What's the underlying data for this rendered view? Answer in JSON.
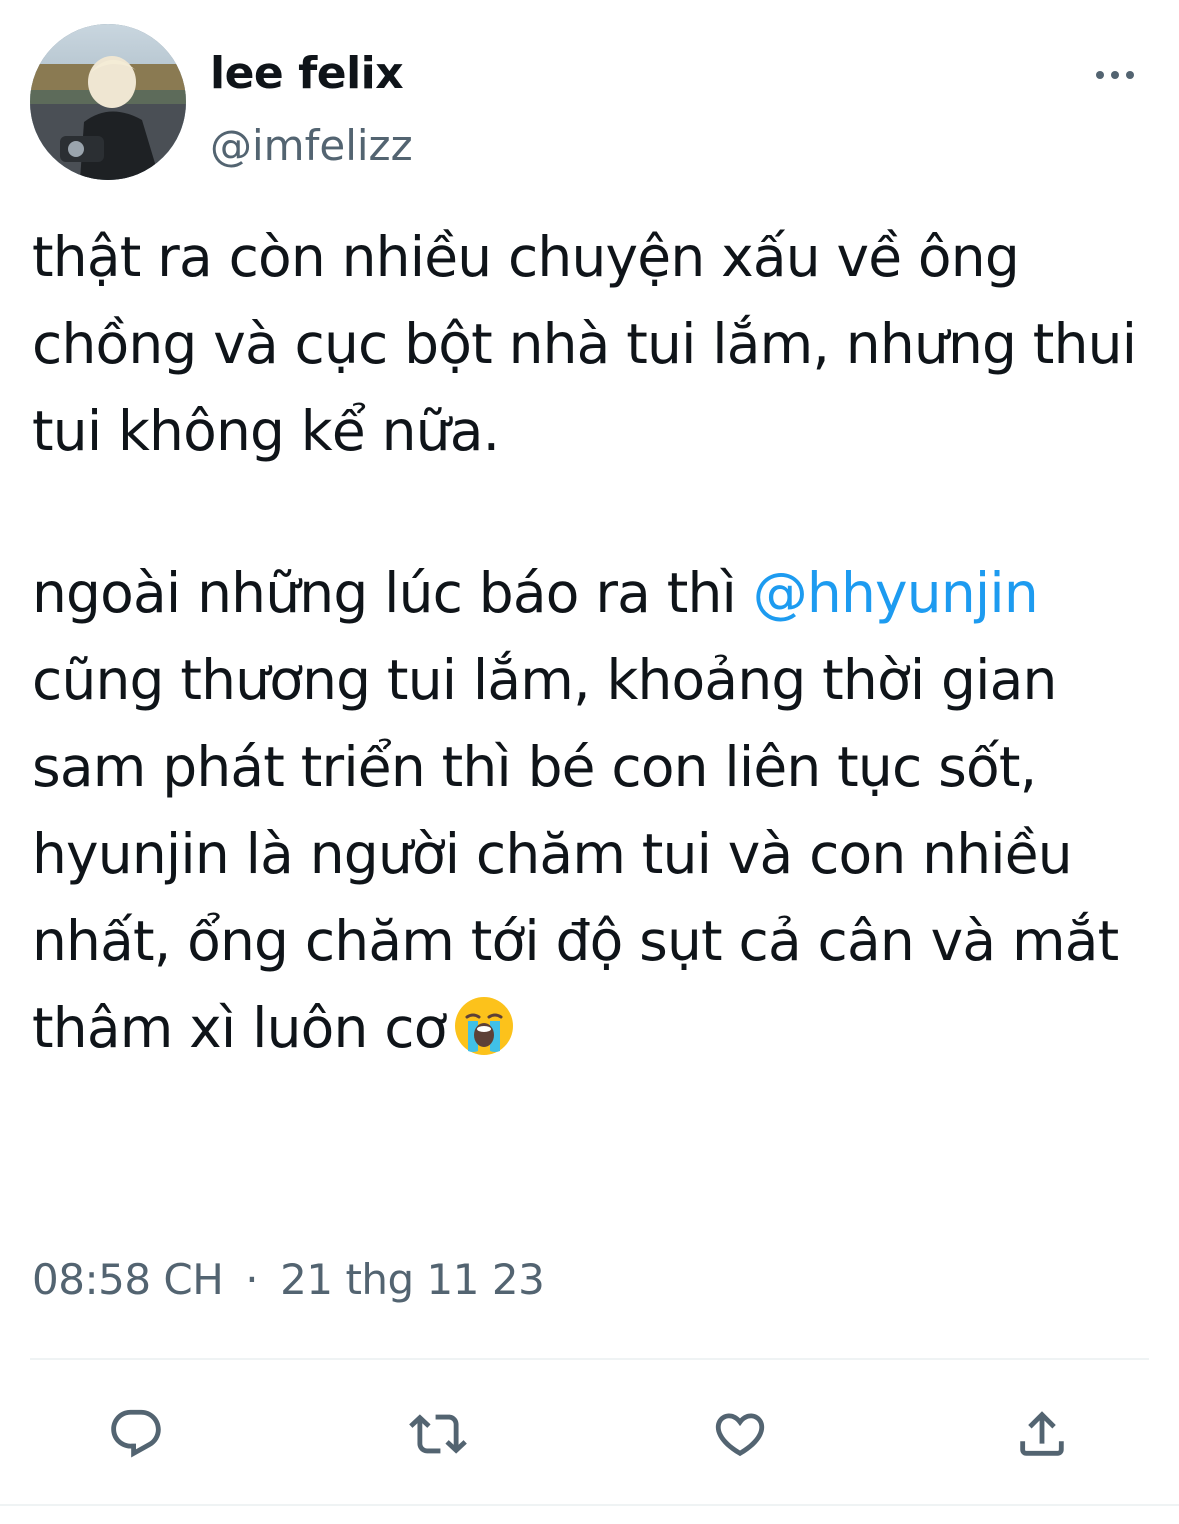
{
  "author": {
    "display_name": "lee felix",
    "handle": "@imfelizz",
    "avatar": "avatar-photo"
  },
  "tweet": {
    "paragraph1": "thật ra còn nhiều chuyện xấu về ông\nchồng và cục bột nhà tui lắm, nhưng thui\ntui không kể nữa.",
    "paragraph2_before_mention": "ngoài những lúc báo ra thì ",
    "mention": "@hhyunjin",
    "paragraph2_after_mention": "\ncũng thương tui lắm, khoảng thời gian\nsam phát triển thì bé con liên tục sốt,\nhyunjin là người chăm tui và con nhiều\nnhất, ổng chăm tới độ sụt cả cân và mắt\nthâm xì luôn cơ",
    "emoji": "loudly-crying-face-emoji",
    "time": "08:58 CH",
    "separator": "·",
    "date": "21 thg 11 23"
  },
  "icons": {
    "more": "more-horizontal-icon",
    "reply": "reply-icon",
    "retweet": "retweet-icon",
    "like": "heart-icon",
    "share": "share-icon"
  },
  "colors": {
    "text": "#0f1419",
    "secondary": "#536471",
    "link": "#1d9bf0",
    "divider": "#eff3f4"
  }
}
